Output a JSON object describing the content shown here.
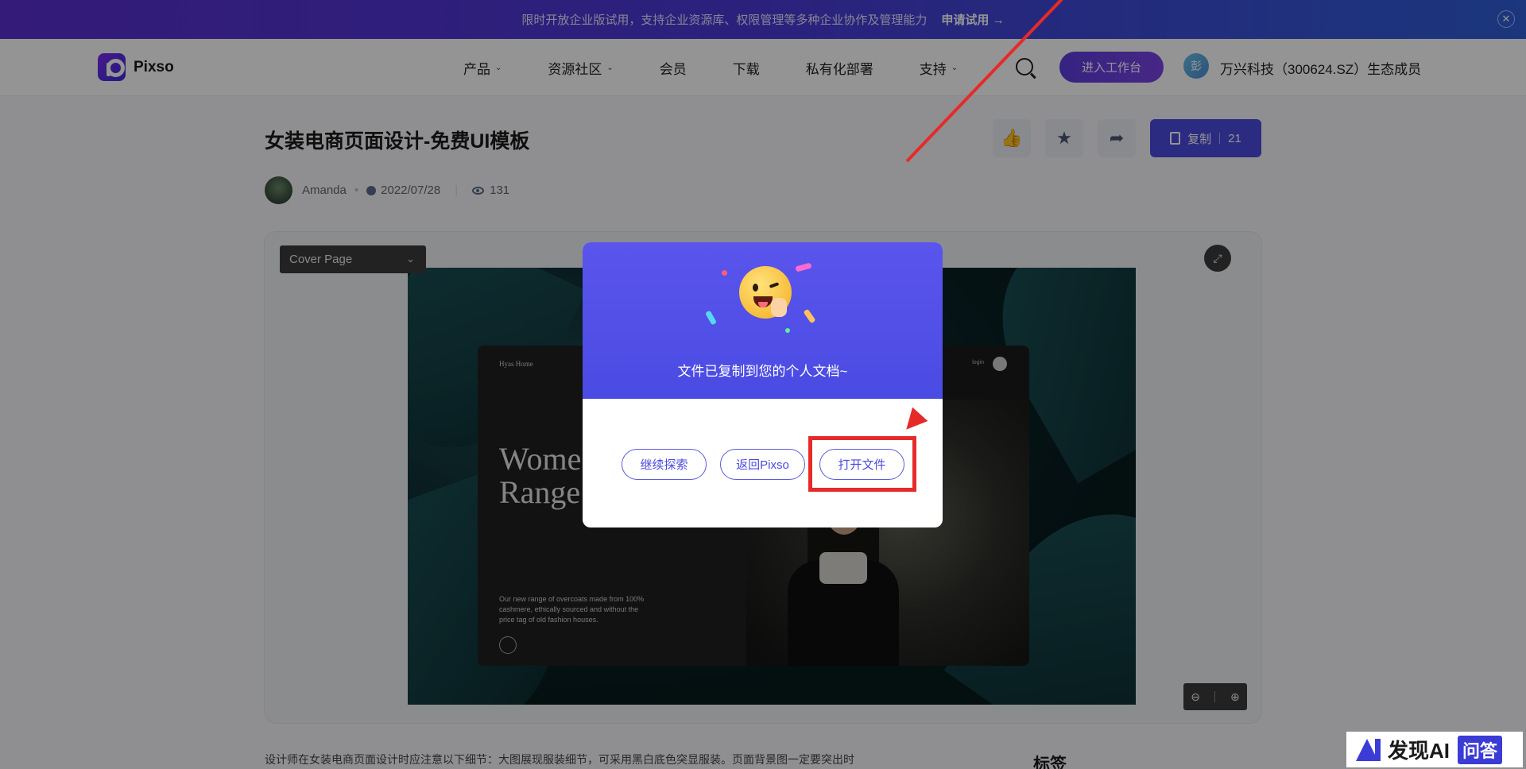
{
  "banner": {
    "text": "限时开放企业版试用，支持企业资源库、权限管理等多种企业协作及管理能力",
    "cta": "申请试用 →",
    "close_icon": "close-icon"
  },
  "nav": {
    "logo_text": "Pixso",
    "items": [
      {
        "label": "产品",
        "has_dropdown": true
      },
      {
        "label": "资源社区",
        "has_dropdown": true
      },
      {
        "label": "会员",
        "has_dropdown": false
      },
      {
        "label": "下载",
        "has_dropdown": false
      },
      {
        "label": "私有化部署",
        "has_dropdown": false
      },
      {
        "label": "支持",
        "has_dropdown": true
      }
    ],
    "chevron": "⌄",
    "search_icon": "search-icon",
    "workbench_label": "进入工作台",
    "avatar_initial": "彭",
    "user_label": "万兴科技（300624.SZ）生态成员"
  },
  "page": {
    "title": "女装电商页面设计-免费UI模板",
    "author": "Amanda",
    "date": "2022/07/28",
    "views": "131",
    "actions": {
      "like_glyph": "👍",
      "star_glyph": "★",
      "share_glyph": "➦"
    },
    "copy": {
      "label": "复制",
      "count": "21"
    }
  },
  "preview": {
    "page_select": "Cover Page",
    "select_chevron": "⌄",
    "expand_glyph": "⤢",
    "zoom_out_glyph": "⊖",
    "zoom_in_glyph": "⊕",
    "mockup": {
      "brand": "Hyas Home",
      "nav_text": "login",
      "headline_line1": "Wome",
      "headline_line2": "Range",
      "body": "Our new range of overcoats made from 100% cashmere, ethically sourced and without the price tag of old fashion houses."
    }
  },
  "description": {
    "text": "设计师在女装电商页面设计时应注意以下细节：大图展现服装细节，可采用黑白底色突显服装。页面背景图一定要突出时",
    "tags_title": "标签"
  },
  "modal": {
    "message": "文件已复制到您的个人文档~",
    "buttons": {
      "continue": "继续探索",
      "back": "返回Pixso",
      "open": "打开文件"
    }
  },
  "watermark": {
    "text": "发现AI",
    "tag": "问答"
  },
  "colors": {
    "accent": "#4a4adf",
    "annotation_red": "#e62a2a"
  }
}
